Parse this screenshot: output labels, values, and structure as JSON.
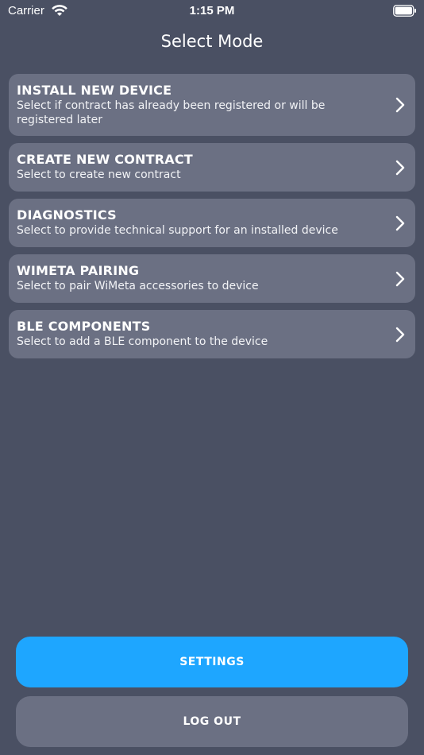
{
  "status_bar": {
    "carrier": "Carrier",
    "time": "1:15 PM",
    "wifi_icon": "wifi-icon",
    "battery_icon": "battery-icon"
  },
  "header": {
    "title": "Select Mode"
  },
  "modes": [
    {
      "title": "INSTALL NEW DEVICE",
      "description": "Select if contract has already been registered or will be registered later"
    },
    {
      "title": "CREATE NEW CONTRACT",
      "description": "Select to create new contract"
    },
    {
      "title": "DIAGNOSTICS",
      "description": "Select to provide technical support for an installed device"
    },
    {
      "title": "WIMETA PAIRING",
      "description": "Select to pair WiMeta accessories to device"
    },
    {
      "title": "BLE COMPONENTS",
      "description": "Select to add a BLE component to the device"
    }
  ],
  "actions": {
    "settings_label": "SETTINGS",
    "logout_label": "LOG OUT"
  },
  "colors": {
    "background": "#4a5063",
    "card": "#6b7083",
    "accent": "#1ea6ff"
  }
}
